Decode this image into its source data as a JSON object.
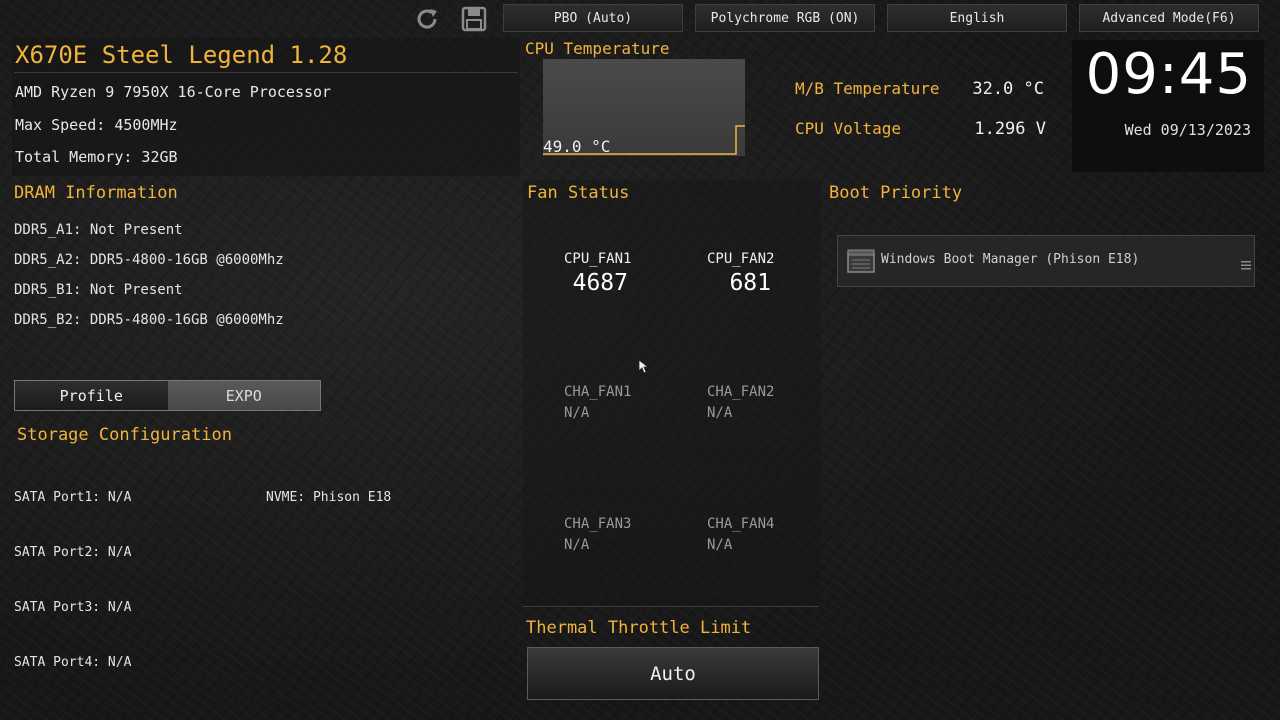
{
  "toolbar": {
    "refresh_icon": "refresh-icon",
    "save_icon": "save-icon",
    "buttons": [
      "PBO (Auto)",
      "Polychrome RGB (ON)",
      "English",
      "Advanced Mode(F6)"
    ]
  },
  "system": {
    "model": "X670E Steel Legend 1.28",
    "cpu": "AMD Ryzen 9 7950X 16-Core Processor",
    "max_speed": "Max Speed: 4500MHz",
    "memory": "Total Memory: 32GB"
  },
  "cpu_temp": {
    "title": "CPU Temperature",
    "value": "49.0 °C"
  },
  "mb": {
    "temp_label": "M/B Temperature",
    "temp_value": "32.0 °C",
    "voltage_label": "CPU Voltage",
    "voltage_value": "1.296 V"
  },
  "clock": {
    "time": "09:45",
    "date": "Wed 09/13/2023"
  },
  "dram": {
    "title": "DRAM Information",
    "slots": [
      "DDR5_A1: Not Present",
      "DDR5_A2: DDR5-4800-16GB @6000Mhz",
      "DDR5_B1: Not Present",
      "DDR5_B2: DDR5-4800-16GB @6000Mhz"
    ],
    "profile_label": "Profile",
    "profile_value": "EXPO"
  },
  "storage": {
    "title": "Storage Configuration",
    "sata": [
      "SATA Port1: N/A",
      "SATA Port2: N/A",
      "SATA Port3: N/A",
      "SATA Port4: N/A"
    ],
    "nvme": "NVME: Phison E18"
  },
  "fans": {
    "title": "Fan Status",
    "items": [
      {
        "name": "CPU_FAN1",
        "value": "4687"
      },
      {
        "name": "CPU_FAN2",
        "value": "681"
      },
      {
        "name": "CHA_FAN1",
        "value": "N/A"
      },
      {
        "name": "CHA_FAN2",
        "value": "N/A"
      },
      {
        "name": "CHA_FAN3",
        "value": "N/A"
      },
      {
        "name": "CHA_FAN4",
        "value": "N/A"
      }
    ]
  },
  "thermal": {
    "title": "Thermal Throttle Limit",
    "value": "Auto"
  },
  "boot": {
    "title": "Boot Priority",
    "items": [
      "Windows Boot Manager (Phison E18)"
    ],
    "drive_icon": "drive-icon",
    "handle_icon": "drag-handle-icon"
  },
  "colors": {
    "accent": "#f0b43c",
    "background": "#1b1b1b"
  }
}
